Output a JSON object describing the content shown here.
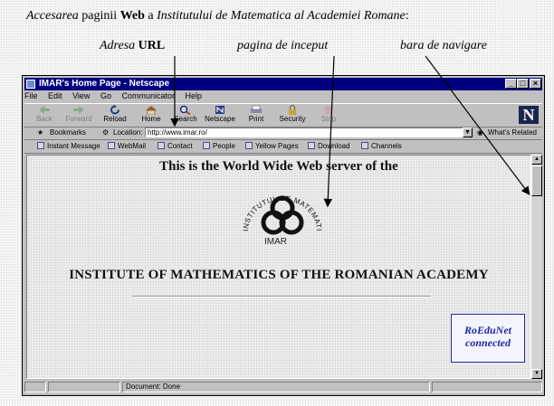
{
  "caption": {
    "part1": "Accesarea",
    "part2": "paginii",
    "part3": "Web",
    "part4": "a",
    "part5": "Institutului de Matematica al Academiei Romane"
  },
  "labels": {
    "url_prefix": "Adresa",
    "url_bold": "URL",
    "homepage": "pagina de inceput",
    "navbar": "bara de navigare"
  },
  "window": {
    "title": "IMAR's Home Page - Netscape",
    "menu": [
      "File",
      "Edit",
      "View",
      "Go",
      "Communicator",
      "Help"
    ],
    "nav_buttons": [
      {
        "label": "Back",
        "enabled": false,
        "icon": "back-arrow-icon"
      },
      {
        "label": "Forward",
        "enabled": false,
        "icon": "forward-arrow-icon"
      },
      {
        "label": "Reload",
        "enabled": true,
        "icon": "reload-icon"
      },
      {
        "label": "Home",
        "enabled": true,
        "icon": "home-icon"
      },
      {
        "label": "Search",
        "enabled": true,
        "icon": "search-icon"
      },
      {
        "label": "Netscape",
        "enabled": true,
        "icon": "netscape-icon"
      },
      {
        "label": "Print",
        "enabled": true,
        "icon": "print-icon"
      },
      {
        "label": "Security",
        "enabled": true,
        "icon": "lock-icon"
      },
      {
        "label": "Stop",
        "enabled": false,
        "icon": "stop-icon"
      }
    ],
    "bookmarks_label": "Bookmarks",
    "location_label": "Location:",
    "url": "http://www.imar.ro/",
    "whats_related": "What's Related",
    "personal": [
      "Instant Message",
      "WebMail",
      "Contact",
      "People",
      "Yellow Pages",
      "Download",
      "Channels"
    ],
    "status": "Document: Done"
  },
  "page": {
    "heading": "This is the World Wide Web server of the",
    "logo_ring": "INSTITUTUL DE MATEMATICA",
    "logo_text": "IMAR",
    "institute": "INSTITUTE OF MATHEMATICS OF THE ROMANIAN ACADEMY",
    "badge_line1": "RoEduNet",
    "badge_line2": "connected"
  },
  "colors": {
    "titlebar": "#000080",
    "chrome": "#c0c0c0",
    "badge_blue": "#1d2a9e"
  }
}
